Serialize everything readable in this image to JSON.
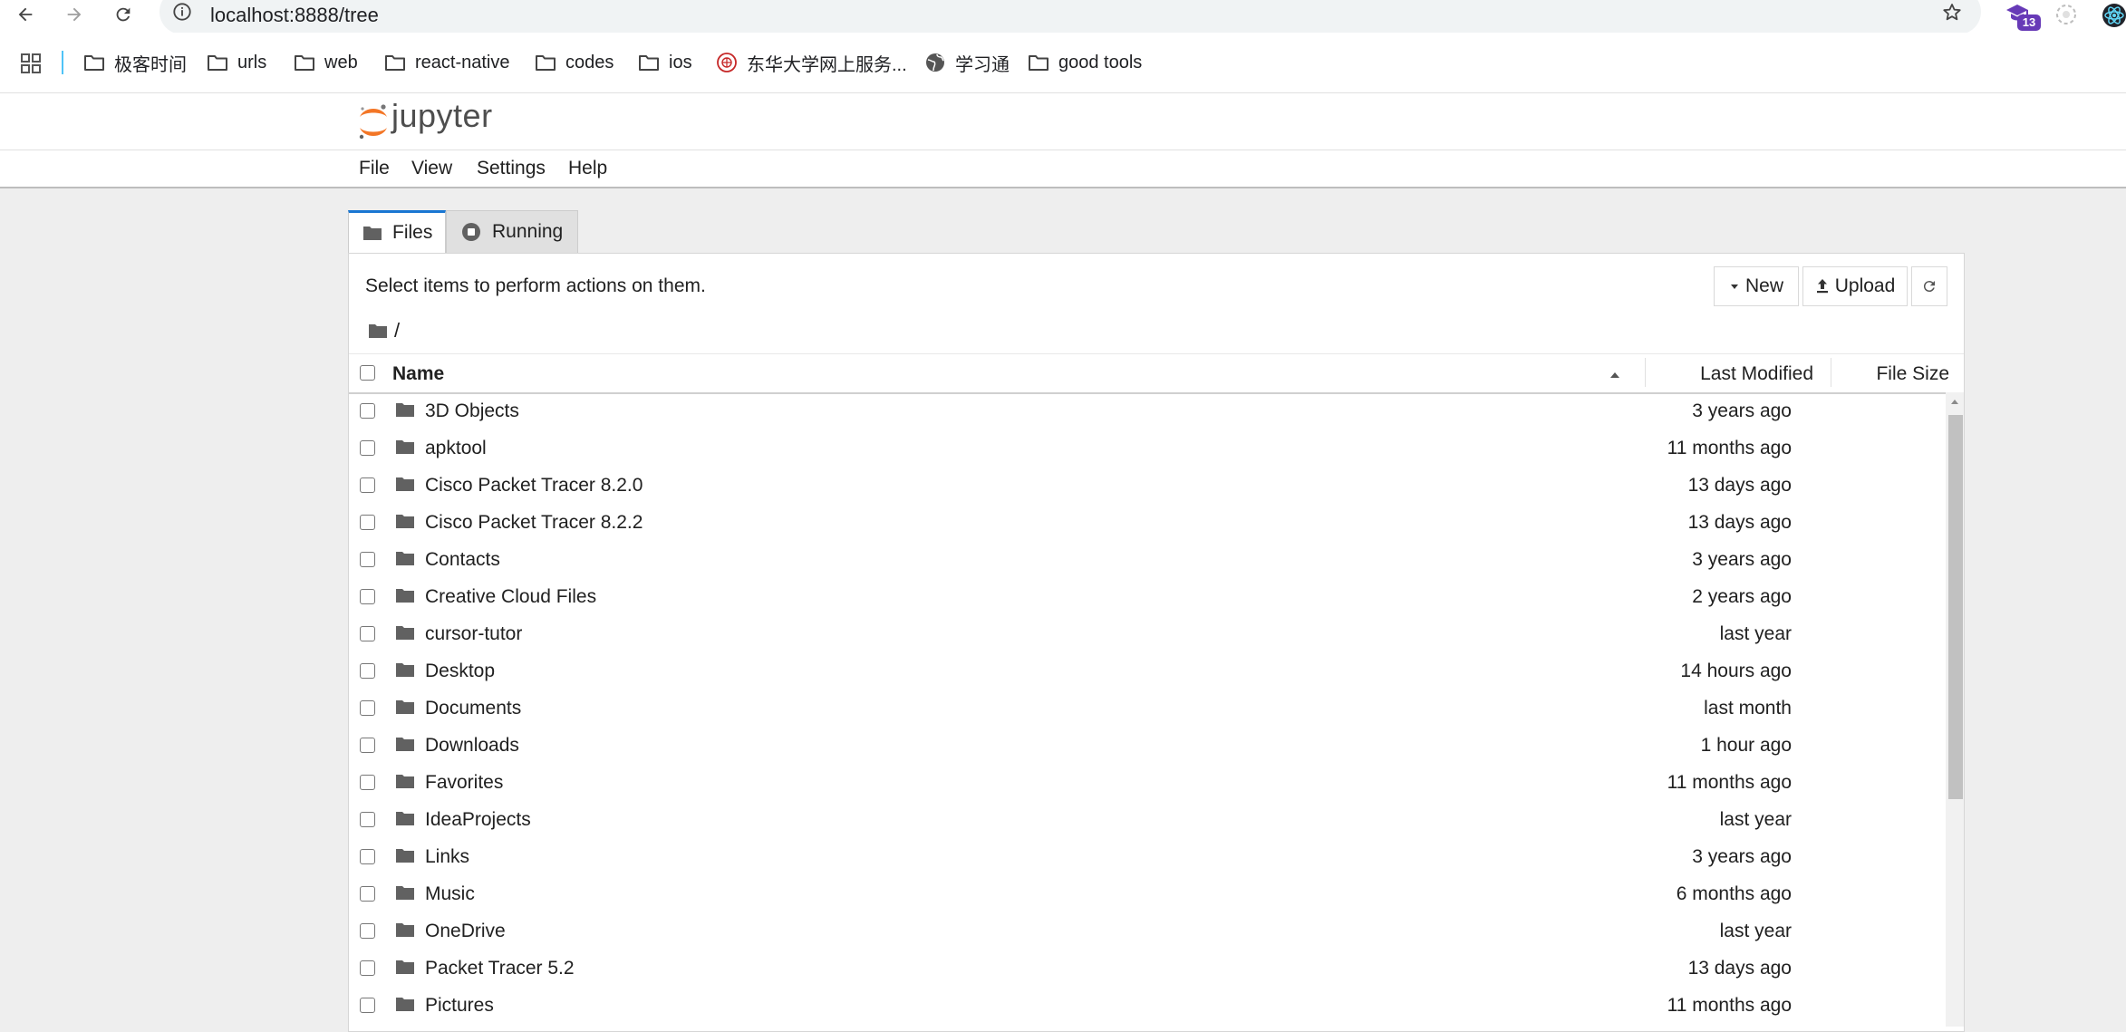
{
  "browser": {
    "url": "localhost:8888/tree",
    "extension_badge": "13",
    "bookmarks": [
      {
        "label": "极客时间",
        "icon": "folder-icon"
      },
      {
        "label": "urls",
        "icon": "folder-icon"
      },
      {
        "label": "web",
        "icon": "folder-icon"
      },
      {
        "label": "react-native",
        "icon": "folder-icon"
      },
      {
        "label": "codes",
        "icon": "folder-icon"
      },
      {
        "label": "ios",
        "icon": "folder-icon"
      },
      {
        "label": "东华大学网上服务...",
        "icon": "university-seal-icon"
      },
      {
        "label": "学习通",
        "icon": "globe-icon"
      },
      {
        "label": "good tools",
        "icon": "folder-icon"
      }
    ]
  },
  "jupyter": {
    "logo_text": "jupyter",
    "menu": [
      "File",
      "View",
      "Settings",
      "Help"
    ],
    "tabs": [
      {
        "label": "Files",
        "icon": "folder-icon",
        "active": true
      },
      {
        "label": "Running",
        "icon": "stop-circle-icon",
        "active": false
      }
    ],
    "toolbar": {
      "hint": "Select items to perform actions on them.",
      "new_label": "New",
      "upload_label": "Upload"
    },
    "breadcrumb": "/",
    "columns": {
      "name": "Name",
      "modified": "Last Modified",
      "size": "File Size"
    },
    "files": [
      {
        "name": "3D Objects",
        "modified": "3 years ago"
      },
      {
        "name": "apktool",
        "modified": "11 months ago"
      },
      {
        "name": "Cisco Packet Tracer 8.2.0",
        "modified": "13 days ago"
      },
      {
        "name": "Cisco Packet Tracer 8.2.2",
        "modified": "13 days ago"
      },
      {
        "name": "Contacts",
        "modified": "3 years ago"
      },
      {
        "name": "Creative Cloud Files",
        "modified": "2 years ago"
      },
      {
        "name": "cursor-tutor",
        "modified": "last year"
      },
      {
        "name": "Desktop",
        "modified": "14 hours ago"
      },
      {
        "name": "Documents",
        "modified": "last month"
      },
      {
        "name": "Downloads",
        "modified": "1 hour ago"
      },
      {
        "name": "Favorites",
        "modified": "11 months ago"
      },
      {
        "name": "IdeaProjects",
        "modified": "last year"
      },
      {
        "name": "Links",
        "modified": "3 years ago"
      },
      {
        "name": "Music",
        "modified": "6 months ago"
      },
      {
        "name": "OneDrive",
        "modified": "last year"
      },
      {
        "name": "Packet Tracer 5.2",
        "modified": "13 days ago"
      },
      {
        "name": "Pictures",
        "modified": "11 months ago"
      }
    ]
  },
  "colors": {
    "accent": "#1976d2",
    "logo_orange": "#f37626",
    "folder": "#616161",
    "extension": "#673ab7"
  }
}
